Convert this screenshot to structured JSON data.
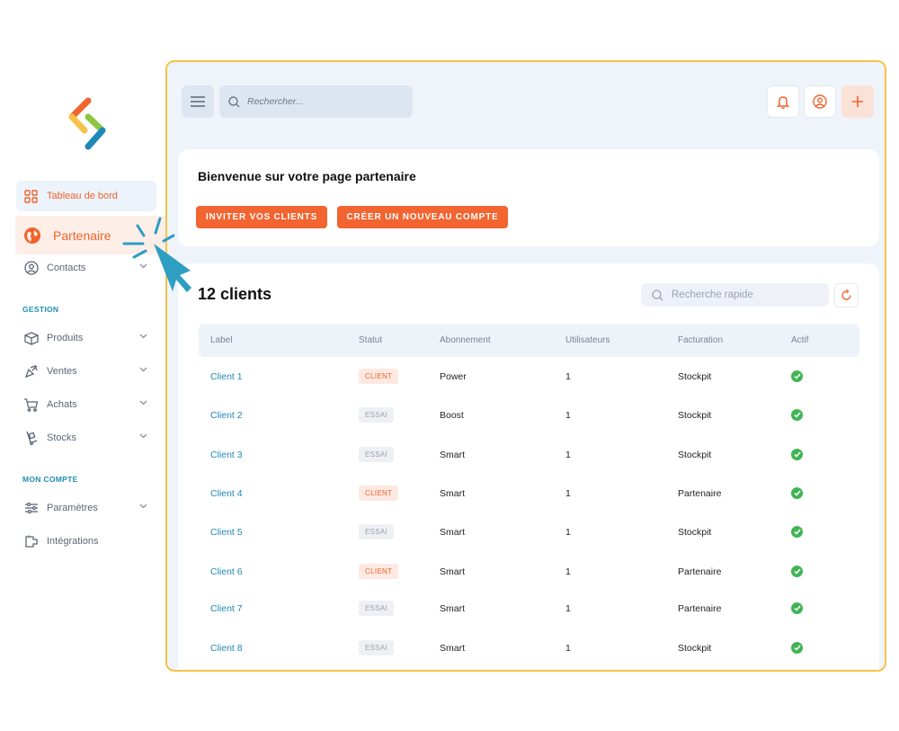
{
  "sidebar": {
    "items": [
      {
        "label": "Tableau de bord",
        "icon": "grid-icon"
      },
      {
        "label": "Partenaire",
        "icon": "globe-icon"
      },
      {
        "label": "Contacts",
        "icon": "user-circle-icon"
      },
      {
        "label": "Produits",
        "icon": "box-icon"
      },
      {
        "label": "Ventes",
        "icon": "megaphone-icon"
      },
      {
        "label": "Achats",
        "icon": "cart-icon"
      },
      {
        "label": "Stocks",
        "icon": "dolly-icon"
      },
      {
        "label": "Paramètres",
        "icon": "sliders-icon"
      },
      {
        "label": "Intégrations",
        "icon": "plugin-icon"
      }
    ],
    "sections": {
      "gestion": "GESTION",
      "mon_compte": "MON COMPTE"
    }
  },
  "topbar": {
    "search_placeholder": "Rechercher..."
  },
  "welcome": {
    "title": "Bienvenue sur votre page partenaire",
    "invite_button": "INVITER VOS CLIENTS",
    "create_button": "CRÉER UN NOUVEAU COMPTE"
  },
  "clients": {
    "title": "12 clients",
    "quick_search_placeholder": "Recherche rapide",
    "columns": [
      "Label",
      "Statut",
      "Abonnement",
      "Utilisateurs",
      "Facturation",
      "Actif"
    ],
    "rows": [
      {
        "label": "Client 1",
        "status": "CLIENT",
        "plan": "Power",
        "users": "1",
        "billing": "Stockpit"
      },
      {
        "label": "Client 2",
        "status": "ESSAI",
        "plan": "Boost",
        "users": "1",
        "billing": "Stockpit"
      },
      {
        "label": "Client 3",
        "status": "ESSAI",
        "plan": "Smart",
        "users": "1",
        "billing": "Stockpit"
      },
      {
        "label": "Client 4",
        "status": "CLIENT",
        "plan": "Smart",
        "users": "1",
        "billing": "Partenaire"
      },
      {
        "label": "Client 5",
        "status": "ESSAI",
        "plan": "Smart",
        "users": "1",
        "billing": "Stockpit"
      },
      {
        "label": "Client 6",
        "status": "CLIENT",
        "plan": "Smart",
        "users": "1",
        "billing": "Partenaire"
      },
      {
        "label": "Client 7",
        "status": "ESSAI",
        "plan": "Smart",
        "users": "1",
        "billing": "Partenaire"
      },
      {
        "label": "Client 8",
        "status": "ESSAI",
        "plan": "Smart",
        "users": "1",
        "billing": "Stockpit"
      }
    ]
  },
  "colors": {
    "accent": "#f26430",
    "link": "#1e88b6",
    "frame": "#f7c24a",
    "success": "#3fb553"
  }
}
